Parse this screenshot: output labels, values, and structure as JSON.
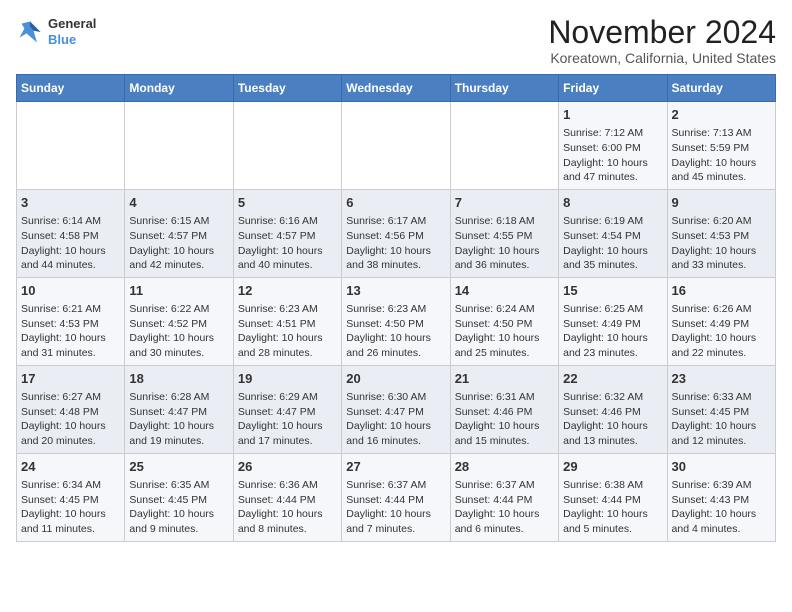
{
  "logo": {
    "line1": "General",
    "line2": "Blue"
  },
  "title": "November 2024",
  "subtitle": "Koreatown, California, United States",
  "days_header": [
    "Sunday",
    "Monday",
    "Tuesday",
    "Wednesday",
    "Thursday",
    "Friday",
    "Saturday"
  ],
  "weeks": [
    [
      {
        "day": "",
        "info": ""
      },
      {
        "day": "",
        "info": ""
      },
      {
        "day": "",
        "info": ""
      },
      {
        "day": "",
        "info": ""
      },
      {
        "day": "",
        "info": ""
      },
      {
        "day": "1",
        "info": "Sunrise: 7:12 AM\nSunset: 6:00 PM\nDaylight: 10 hours and 47 minutes."
      },
      {
        "day": "2",
        "info": "Sunrise: 7:13 AM\nSunset: 5:59 PM\nDaylight: 10 hours and 45 minutes."
      }
    ],
    [
      {
        "day": "3",
        "info": "Sunrise: 6:14 AM\nSunset: 4:58 PM\nDaylight: 10 hours and 44 minutes."
      },
      {
        "day": "4",
        "info": "Sunrise: 6:15 AM\nSunset: 4:57 PM\nDaylight: 10 hours and 42 minutes."
      },
      {
        "day": "5",
        "info": "Sunrise: 6:16 AM\nSunset: 4:57 PM\nDaylight: 10 hours and 40 minutes."
      },
      {
        "day": "6",
        "info": "Sunrise: 6:17 AM\nSunset: 4:56 PM\nDaylight: 10 hours and 38 minutes."
      },
      {
        "day": "7",
        "info": "Sunrise: 6:18 AM\nSunset: 4:55 PM\nDaylight: 10 hours and 36 minutes."
      },
      {
        "day": "8",
        "info": "Sunrise: 6:19 AM\nSunset: 4:54 PM\nDaylight: 10 hours and 35 minutes."
      },
      {
        "day": "9",
        "info": "Sunrise: 6:20 AM\nSunset: 4:53 PM\nDaylight: 10 hours and 33 minutes."
      }
    ],
    [
      {
        "day": "10",
        "info": "Sunrise: 6:21 AM\nSunset: 4:53 PM\nDaylight: 10 hours and 31 minutes."
      },
      {
        "day": "11",
        "info": "Sunrise: 6:22 AM\nSunset: 4:52 PM\nDaylight: 10 hours and 30 minutes."
      },
      {
        "day": "12",
        "info": "Sunrise: 6:23 AM\nSunset: 4:51 PM\nDaylight: 10 hours and 28 minutes."
      },
      {
        "day": "13",
        "info": "Sunrise: 6:23 AM\nSunset: 4:50 PM\nDaylight: 10 hours and 26 minutes."
      },
      {
        "day": "14",
        "info": "Sunrise: 6:24 AM\nSunset: 4:50 PM\nDaylight: 10 hours and 25 minutes."
      },
      {
        "day": "15",
        "info": "Sunrise: 6:25 AM\nSunset: 4:49 PM\nDaylight: 10 hours and 23 minutes."
      },
      {
        "day": "16",
        "info": "Sunrise: 6:26 AM\nSunset: 4:49 PM\nDaylight: 10 hours and 22 minutes."
      }
    ],
    [
      {
        "day": "17",
        "info": "Sunrise: 6:27 AM\nSunset: 4:48 PM\nDaylight: 10 hours and 20 minutes."
      },
      {
        "day": "18",
        "info": "Sunrise: 6:28 AM\nSunset: 4:47 PM\nDaylight: 10 hours and 19 minutes."
      },
      {
        "day": "19",
        "info": "Sunrise: 6:29 AM\nSunset: 4:47 PM\nDaylight: 10 hours and 17 minutes."
      },
      {
        "day": "20",
        "info": "Sunrise: 6:30 AM\nSunset: 4:47 PM\nDaylight: 10 hours and 16 minutes."
      },
      {
        "day": "21",
        "info": "Sunrise: 6:31 AM\nSunset: 4:46 PM\nDaylight: 10 hours and 15 minutes."
      },
      {
        "day": "22",
        "info": "Sunrise: 6:32 AM\nSunset: 4:46 PM\nDaylight: 10 hours and 13 minutes."
      },
      {
        "day": "23",
        "info": "Sunrise: 6:33 AM\nSunset: 4:45 PM\nDaylight: 10 hours and 12 minutes."
      }
    ],
    [
      {
        "day": "24",
        "info": "Sunrise: 6:34 AM\nSunset: 4:45 PM\nDaylight: 10 hours and 11 minutes."
      },
      {
        "day": "25",
        "info": "Sunrise: 6:35 AM\nSunset: 4:45 PM\nDaylight: 10 hours and 9 minutes."
      },
      {
        "day": "26",
        "info": "Sunrise: 6:36 AM\nSunset: 4:44 PM\nDaylight: 10 hours and 8 minutes."
      },
      {
        "day": "27",
        "info": "Sunrise: 6:37 AM\nSunset: 4:44 PM\nDaylight: 10 hours and 7 minutes."
      },
      {
        "day": "28",
        "info": "Sunrise: 6:37 AM\nSunset: 4:44 PM\nDaylight: 10 hours and 6 minutes."
      },
      {
        "day": "29",
        "info": "Sunrise: 6:38 AM\nSunset: 4:44 PM\nDaylight: 10 hours and 5 minutes."
      },
      {
        "day": "30",
        "info": "Sunrise: 6:39 AM\nSunset: 4:43 PM\nDaylight: 10 hours and 4 minutes."
      }
    ]
  ]
}
